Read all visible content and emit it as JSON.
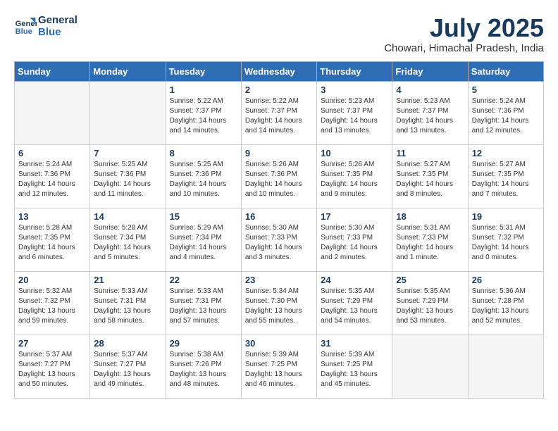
{
  "header": {
    "logo_line1": "General",
    "logo_line2": "Blue",
    "month_year": "July 2025",
    "location": "Chowari, Himachal Pradesh, India"
  },
  "days_of_week": [
    "Sunday",
    "Monday",
    "Tuesday",
    "Wednesday",
    "Thursday",
    "Friday",
    "Saturday"
  ],
  "weeks": [
    [
      {
        "day": "",
        "info": ""
      },
      {
        "day": "",
        "info": ""
      },
      {
        "day": "1",
        "info": "Sunrise: 5:22 AM\nSunset: 7:37 PM\nDaylight: 14 hours and 14 minutes."
      },
      {
        "day": "2",
        "info": "Sunrise: 5:22 AM\nSunset: 7:37 PM\nDaylight: 14 hours and 14 minutes."
      },
      {
        "day": "3",
        "info": "Sunrise: 5:23 AM\nSunset: 7:37 PM\nDaylight: 14 hours and 13 minutes."
      },
      {
        "day": "4",
        "info": "Sunrise: 5:23 AM\nSunset: 7:37 PM\nDaylight: 14 hours and 13 minutes."
      },
      {
        "day": "5",
        "info": "Sunrise: 5:24 AM\nSunset: 7:36 PM\nDaylight: 14 hours and 12 minutes."
      }
    ],
    [
      {
        "day": "6",
        "info": "Sunrise: 5:24 AM\nSunset: 7:36 PM\nDaylight: 14 hours and 12 minutes."
      },
      {
        "day": "7",
        "info": "Sunrise: 5:25 AM\nSunset: 7:36 PM\nDaylight: 14 hours and 11 minutes."
      },
      {
        "day": "8",
        "info": "Sunrise: 5:25 AM\nSunset: 7:36 PM\nDaylight: 14 hours and 10 minutes."
      },
      {
        "day": "9",
        "info": "Sunrise: 5:26 AM\nSunset: 7:36 PM\nDaylight: 14 hours and 10 minutes."
      },
      {
        "day": "10",
        "info": "Sunrise: 5:26 AM\nSunset: 7:35 PM\nDaylight: 14 hours and 9 minutes."
      },
      {
        "day": "11",
        "info": "Sunrise: 5:27 AM\nSunset: 7:35 PM\nDaylight: 14 hours and 8 minutes."
      },
      {
        "day": "12",
        "info": "Sunrise: 5:27 AM\nSunset: 7:35 PM\nDaylight: 14 hours and 7 minutes."
      }
    ],
    [
      {
        "day": "13",
        "info": "Sunrise: 5:28 AM\nSunset: 7:35 PM\nDaylight: 14 hours and 6 minutes."
      },
      {
        "day": "14",
        "info": "Sunrise: 5:28 AM\nSunset: 7:34 PM\nDaylight: 14 hours and 5 minutes."
      },
      {
        "day": "15",
        "info": "Sunrise: 5:29 AM\nSunset: 7:34 PM\nDaylight: 14 hours and 4 minutes."
      },
      {
        "day": "16",
        "info": "Sunrise: 5:30 AM\nSunset: 7:33 PM\nDaylight: 14 hours and 3 minutes."
      },
      {
        "day": "17",
        "info": "Sunrise: 5:30 AM\nSunset: 7:33 PM\nDaylight: 14 hours and 2 minutes."
      },
      {
        "day": "18",
        "info": "Sunrise: 5:31 AM\nSunset: 7:33 PM\nDaylight: 14 hours and 1 minute."
      },
      {
        "day": "19",
        "info": "Sunrise: 5:31 AM\nSunset: 7:32 PM\nDaylight: 14 hours and 0 minutes."
      }
    ],
    [
      {
        "day": "20",
        "info": "Sunrise: 5:32 AM\nSunset: 7:32 PM\nDaylight: 13 hours and 59 minutes."
      },
      {
        "day": "21",
        "info": "Sunrise: 5:33 AM\nSunset: 7:31 PM\nDaylight: 13 hours and 58 minutes."
      },
      {
        "day": "22",
        "info": "Sunrise: 5:33 AM\nSunset: 7:31 PM\nDaylight: 13 hours and 57 minutes."
      },
      {
        "day": "23",
        "info": "Sunrise: 5:34 AM\nSunset: 7:30 PM\nDaylight: 13 hours and 55 minutes."
      },
      {
        "day": "24",
        "info": "Sunrise: 5:35 AM\nSunset: 7:29 PM\nDaylight: 13 hours and 54 minutes."
      },
      {
        "day": "25",
        "info": "Sunrise: 5:35 AM\nSunset: 7:29 PM\nDaylight: 13 hours and 53 minutes."
      },
      {
        "day": "26",
        "info": "Sunrise: 5:36 AM\nSunset: 7:28 PM\nDaylight: 13 hours and 52 minutes."
      }
    ],
    [
      {
        "day": "27",
        "info": "Sunrise: 5:37 AM\nSunset: 7:27 PM\nDaylight: 13 hours and 50 minutes."
      },
      {
        "day": "28",
        "info": "Sunrise: 5:37 AM\nSunset: 7:27 PM\nDaylight: 13 hours and 49 minutes."
      },
      {
        "day": "29",
        "info": "Sunrise: 5:38 AM\nSunset: 7:26 PM\nDaylight: 13 hours and 48 minutes."
      },
      {
        "day": "30",
        "info": "Sunrise: 5:39 AM\nSunset: 7:25 PM\nDaylight: 13 hours and 46 minutes."
      },
      {
        "day": "31",
        "info": "Sunrise: 5:39 AM\nSunset: 7:25 PM\nDaylight: 13 hours and 45 minutes."
      },
      {
        "day": "",
        "info": ""
      },
      {
        "day": "",
        "info": ""
      }
    ]
  ]
}
